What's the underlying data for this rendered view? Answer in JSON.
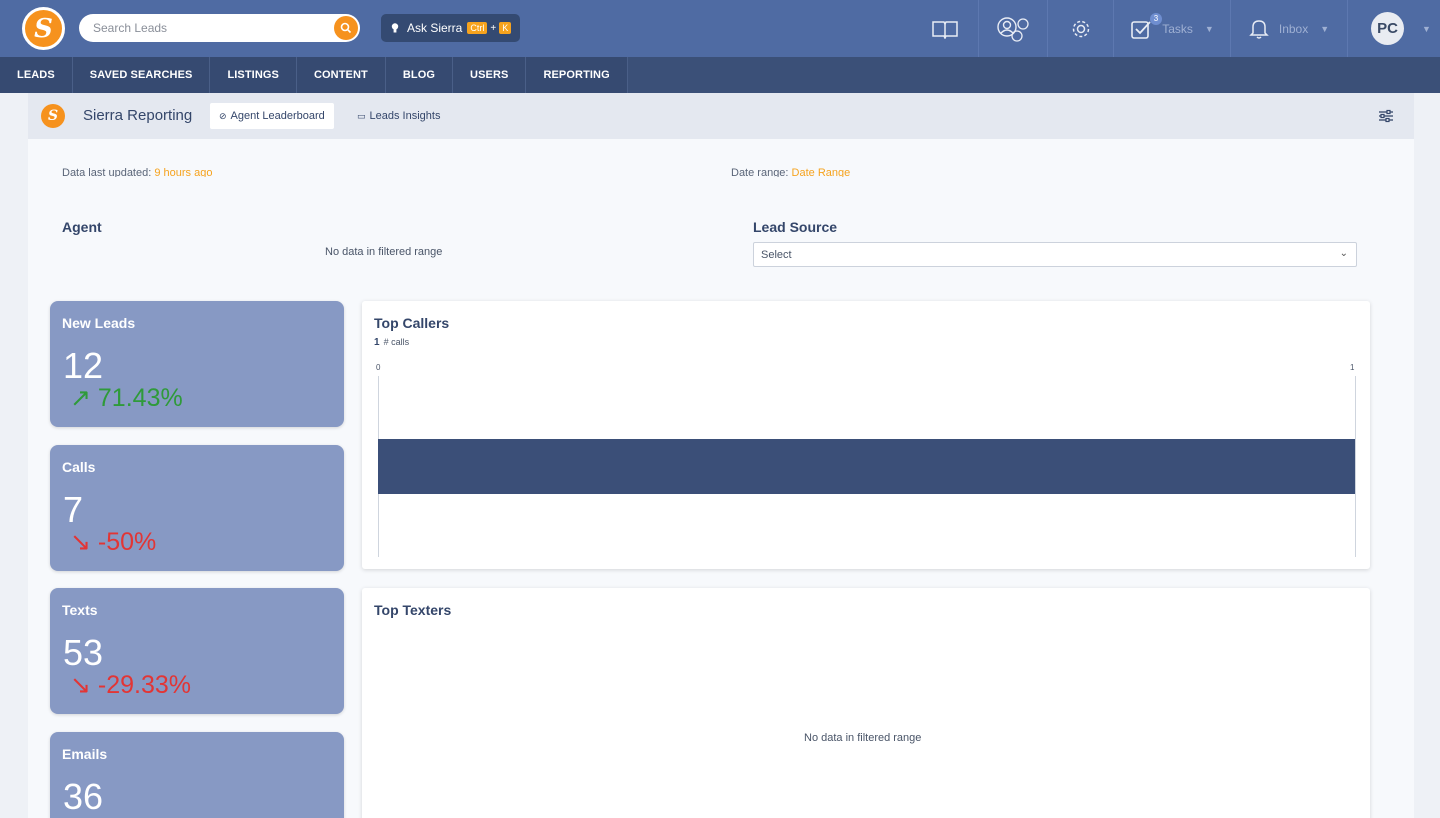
{
  "topbar": {
    "search_placeholder": "Search Leads",
    "ask": {
      "label": "Ask Sierra",
      "key1": "Ctrl",
      "plus": "+",
      "key2": "K"
    },
    "tasks": {
      "label": "Tasks",
      "badge": "3"
    },
    "inbox": {
      "label": "Inbox"
    },
    "avatar": "PC"
  },
  "nav": [
    "LEADS",
    "SAVED SEARCHES",
    "LISTINGS",
    "CONTENT",
    "BLOG",
    "USERS",
    "REPORTING"
  ],
  "subheader": {
    "title": "Sierra Reporting",
    "tabs": [
      "Agent Leaderboard",
      "Leads Insights"
    ]
  },
  "filters": {
    "last_updated_label": "Data last updated:",
    "last_updated_value": "9 hours ago",
    "date_range_label": "Date range:",
    "date_range_value": "Date Range",
    "agent_label": "Agent",
    "agent_nodata": "No data in filtered range",
    "lead_source_label": "Lead Source",
    "lead_source_value": "Select"
  },
  "kpis": [
    {
      "title": "New Leads",
      "value": "12",
      "change": "71.43%",
      "direction": "up",
      "arrow": "↗"
    },
    {
      "title": "Calls",
      "value": "7",
      "change": "-50%",
      "direction": "down",
      "arrow": "↘"
    },
    {
      "title": "Texts",
      "value": "53",
      "change": "-29.33%",
      "direction": "down",
      "arrow": "↘"
    },
    {
      "title": "Emails",
      "value": "36"
    }
  ],
  "top_callers": {
    "title": "Top Callers",
    "legend_value": "1",
    "legend_label": "# calls"
  },
  "top_texters": {
    "title": "Top Texters",
    "nodata": "No data in filtered range"
  },
  "chart_data": {
    "type": "bar",
    "orientation": "horizontal",
    "categories": [
      ""
    ],
    "series": [
      {
        "name": "# calls",
        "values": [
          1
        ]
      }
    ],
    "xlim": [
      0,
      1
    ],
    "tick_labels": [
      "0",
      "1"
    ],
    "title": "Top Callers",
    "color": "#3b4f78"
  },
  "colors": {
    "topbar": "#4f6ba3",
    "nav": "#364a71",
    "accent": "#f6921e",
    "kpi": "#8799c4",
    "up": "#2f9a3a",
    "down": "#e23535"
  }
}
